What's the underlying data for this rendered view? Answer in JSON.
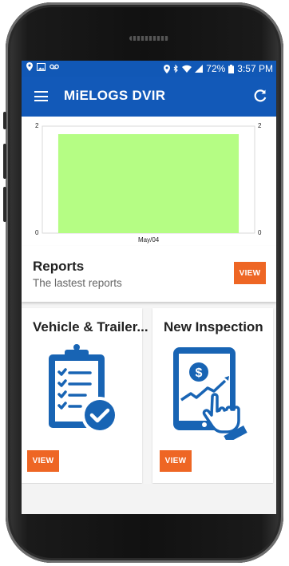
{
  "status_bar": {
    "battery": "72%",
    "time": "3:57 PM"
  },
  "app_bar": {
    "title": "MiELOGS DVIR"
  },
  "chart_data": {
    "type": "bar",
    "categories": [
      "May/04"
    ],
    "values": [
      1.85
    ],
    "ylim": [
      0,
      2
    ],
    "y_ticks_left": [
      "2",
      "0"
    ],
    "y_ticks_right": [
      "2",
      "0"
    ],
    "bar_color": "#b5fd84",
    "grid": false
  },
  "reports": {
    "title": "Reports",
    "subtitle": "The lastest reports",
    "button": "VIEW"
  },
  "tiles": [
    {
      "title": "Vehicle & Trailer...",
      "button": "VIEW",
      "icon": "checklist-clipboard-icon"
    },
    {
      "title": "New Inspection",
      "button": "VIEW",
      "icon": "tablet-dollar-touch-icon"
    }
  ],
  "colors": {
    "primary": "#1259b8",
    "accent": "#ee6624",
    "icon_blue": "#1864b4"
  }
}
